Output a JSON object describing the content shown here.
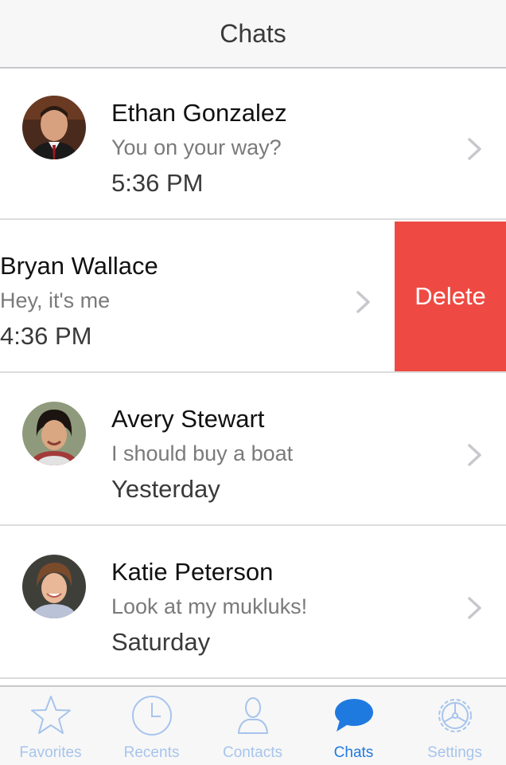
{
  "navbar": {
    "title": "Chats"
  },
  "chats": [
    {
      "name": "Ethan Gonzalez",
      "message": "You on your way?",
      "time": "5:36 PM"
    },
    {
      "name": "Bryan Wallace",
      "message": "Hey, it's me",
      "time": "4:36 PM",
      "delete_label": "Delete"
    },
    {
      "name": "Avery Stewart",
      "message": "I should buy a boat",
      "time": "Yesterday"
    },
    {
      "name": "Katie Peterson",
      "message": "Look at my mukluks!",
      "time": "Saturday"
    }
  ],
  "tabbar": {
    "items": [
      {
        "label": "Favorites",
        "icon": "star-icon"
      },
      {
        "label": "Recents",
        "icon": "clock-icon"
      },
      {
        "label": "Contacts",
        "icon": "person-icon"
      },
      {
        "label": "Chats",
        "icon": "chat-bubble-icon",
        "active": true
      },
      {
        "label": "Settings",
        "icon": "gear-icon"
      }
    ]
  },
  "colors": {
    "accent": "#1f7ae0",
    "inactive_tab": "#a7c4ec",
    "delete": "#ee4a43",
    "chevron": "#c7c7cc"
  }
}
